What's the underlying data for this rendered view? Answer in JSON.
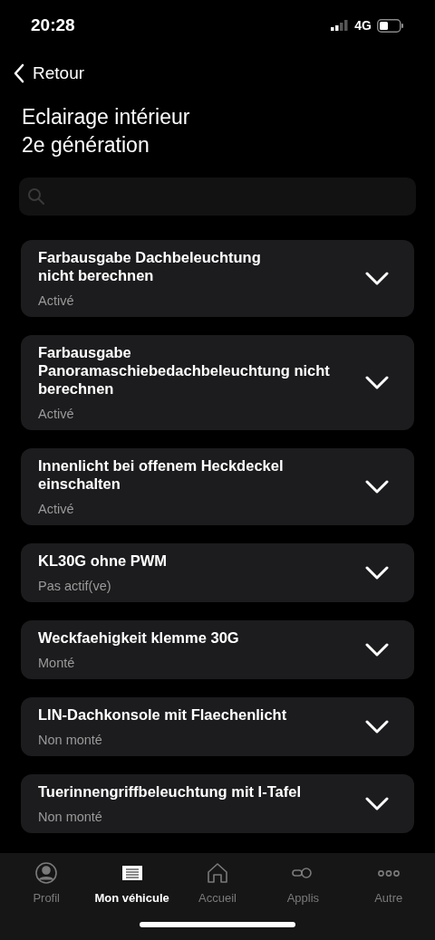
{
  "status_bar": {
    "time": "20:28",
    "network": "4G"
  },
  "back": {
    "label": "Retour"
  },
  "title": "Eclairage intérieur\n2e génération",
  "items": [
    {
      "title": "Farbausgabe Dachbeleuchtung\nnicht berechnen",
      "value": "Activé",
      "expanded": false
    },
    {
      "title": "Farbausgabe\nPanoramaschiebedachbeleuchtung nicht\nberechnen",
      "value": "Activé",
      "expanded": false
    },
    {
      "title": "Innenlicht bei offenem Heckdeckel\neinschalten",
      "value": "Activé",
      "expanded": false
    },
    {
      "title": "KL30G ohne PWM",
      "value": "Pas actif(ve)",
      "expanded": false
    },
    {
      "title": "Weckfaehigkeit klemme 30G",
      "value": "Monté",
      "expanded": false
    },
    {
      "title": "LIN-Dachkonsole mit Flaechenlicht",
      "value": "Non monté",
      "expanded": false
    },
    {
      "title": "Tuerinnengriffbeleuchtung mit I-Tafel",
      "value": "Non monté",
      "expanded": false
    }
  ],
  "tab_bar": [
    {
      "kind": "profile",
      "label": "Profil",
      "selected": false
    },
    {
      "kind": "vehicle",
      "label": "Mon véhicule",
      "selected": true
    },
    {
      "kind": "home",
      "label": "Accueil",
      "selected": false
    },
    {
      "kind": "apps",
      "label": "Applis",
      "selected": false
    },
    {
      "kind": "more",
      "label": "Autre",
      "selected": false
    }
  ]
}
